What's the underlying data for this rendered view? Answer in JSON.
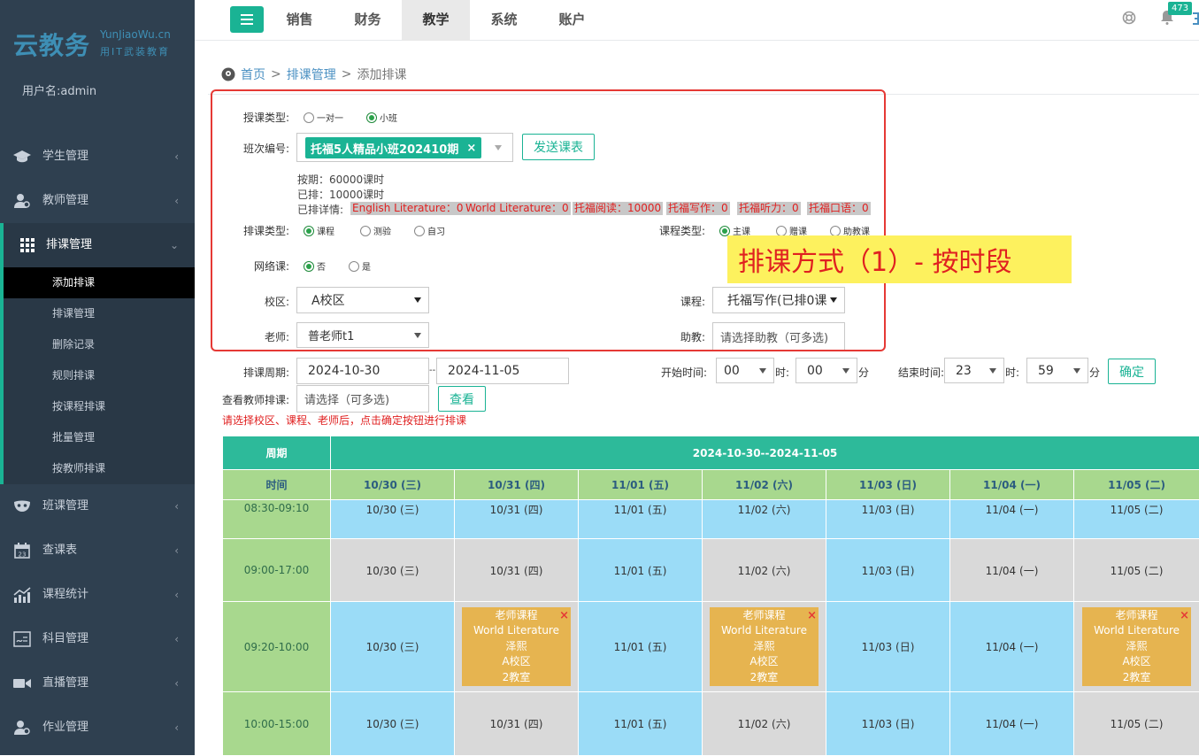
{
  "brand": {
    "name": "云教务",
    "domain": "YunJiaoWu.cn",
    "slogan": "用IT武装教育"
  },
  "user": {
    "label": "用户名:admin"
  },
  "sidebar": {
    "items": [
      {
        "label": "学生管理",
        "icon": "graduation-cap-icon"
      },
      {
        "label": "教师管理",
        "icon": "teacher-icon"
      },
      {
        "label": "排课管理",
        "icon": "grid-icon",
        "active": true
      },
      {
        "label": "班课管理",
        "icon": "mask-icon"
      },
      {
        "label": "查课表",
        "icon": "calendar-icon"
      },
      {
        "label": "课程统计",
        "icon": "chart-icon"
      },
      {
        "label": "科目管理",
        "icon": "subject-icon"
      },
      {
        "label": "直播管理",
        "icon": "video-icon"
      },
      {
        "label": "作业管理",
        "icon": "homework-icon"
      }
    ],
    "sub": [
      "添加排课",
      "排课管理",
      "删除记录",
      "规则排课",
      "按课程排课",
      "批量管理",
      "按教师排课"
    ]
  },
  "topnav": {
    "items": [
      "销售",
      "财务",
      "教学",
      "系统",
      "账户"
    ],
    "active": "教学",
    "badge": "473"
  },
  "breadcrumb": {
    "home": "首页",
    "sep": ">",
    "parent": "排课管理",
    "current": "添加排课"
  },
  "form": {
    "teach_type": {
      "label": "授课类型:",
      "options": [
        "一对一",
        "小班"
      ],
      "selected": "小班"
    },
    "class_no": {
      "label": "班次编号:",
      "value": "托福5人精品小班202410期",
      "send": "发送课表"
    },
    "hours": {
      "total": "按期：60000课时",
      "done": "已排：10000课时",
      "detail_label": "已排详情:"
    },
    "details": [
      "English Literature：0",
      "World Literature：0",
      "托福阅读：10000",
      "托福写作：0",
      "托福听力：0",
      "托福口语：0"
    ],
    "sched_type": {
      "label": "排课类型:",
      "options": [
        "课程",
        "测验",
        "自习"
      ],
      "selected": "课程"
    },
    "course_type": {
      "label": "课程类型:",
      "options": [
        "主课",
        "赠课",
        "助教课"
      ],
      "selected": "主课"
    },
    "online": {
      "label": "网络课:",
      "options": [
        "否",
        "是"
      ],
      "selected": "否"
    },
    "campus": {
      "label": "校区:",
      "value": "A校区"
    },
    "course": {
      "label": "课程:",
      "value": "托福写作(已排0课"
    },
    "teacher": {
      "label": "老师:",
      "value": "普老师t1"
    },
    "assistant": {
      "label": "助教:",
      "placeholder": "请选择助教（可多选)"
    },
    "period": {
      "label": "排课周期:",
      "start": "2024-10-30",
      "sep": "--",
      "end": "2024-11-05"
    },
    "start_time": {
      "label": "开始时间:",
      "hour": "00",
      "min": "00"
    },
    "end_time": {
      "label": "结束时间:",
      "hour": "23",
      "min": "59"
    },
    "units": {
      "h": "时:",
      "m": "分"
    },
    "confirm": "确定",
    "view_teacher": {
      "label": "查看教师排课:",
      "placeholder": "请选择（可多选)",
      "button": "查看"
    },
    "hint": "请选择校区、课程、老师后，点击确定按钮进行排课"
  },
  "callout": "排课方式（1）- 按时段",
  "schedule": {
    "head_week": "周期",
    "head_range": "2024-10-30--2024-11-05",
    "head_time": "时间",
    "days": [
      "10/30 (三)",
      "10/31 (四)",
      "11/01 (五)",
      "11/02 (六)",
      "11/03 (日)",
      "11/04 (一)",
      "11/05 (二)"
    ],
    "rows": [
      {
        "time": "08:30-09:10",
        "cells": [
          "10/30 (三)",
          "10/31 (四)",
          "11/01 (五)",
          "11/02 (六)",
          "11/03 (日)",
          "11/04 (一)",
          "11/05 (二)"
        ]
      },
      {
        "time": "09:00-17:00",
        "cells": [
          "10/30 (三)",
          "10/31 (四)",
          "11/01 (五)",
          "11/02 (六)",
          "11/03 (日)",
          "11/04 (一)",
          "11/05 (二)"
        ]
      },
      {
        "time": "09:20-10:00",
        "cells": [
          "10/30 (三)",
          "",
          "11/01 (五)",
          "",
          "11/03 (日)",
          "11/04 (一)",
          ""
        ]
      },
      {
        "time": "10:00-15:00",
        "cells": [
          "10/30 (三)",
          "10/31 (四)",
          "11/01 (五)",
          "11/02 (六)",
          "11/03 (日)",
          "11/04 (一)",
          "11/05 (二)"
        ]
      }
    ],
    "event": {
      "title": "老师课程",
      "course": "World Literature",
      "teacher": "泽熙",
      "campus": "A校区",
      "room": "2教室",
      "close": "×"
    }
  }
}
